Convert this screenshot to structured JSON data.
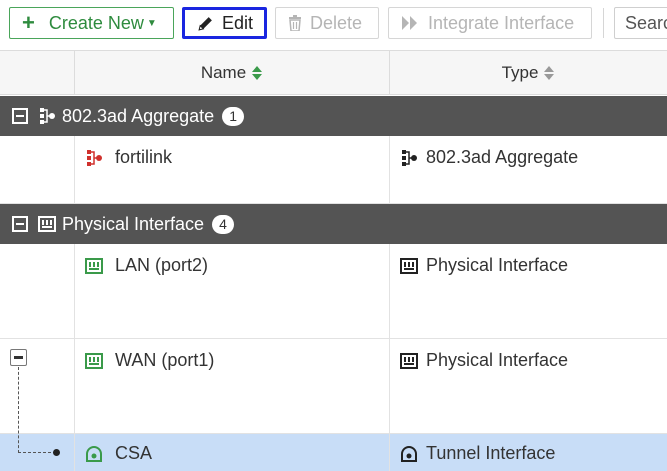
{
  "toolbar": {
    "create_label": "Create New",
    "edit_label": "Edit",
    "delete_label": "Delete",
    "integrate_label": "Integrate Interface",
    "search_placeholder": "Search"
  },
  "columns": {
    "name": "Name",
    "type": "Type"
  },
  "groups": [
    {
      "label": "802.3ad Aggregate",
      "count": "1"
    },
    {
      "label": "Physical Interface",
      "count": "4"
    }
  ],
  "rows": [
    {
      "name": "fortilink",
      "type": "802.3ad Aggregate",
      "name_icon": "aggregate-icon",
      "type_icon": "aggregate-icon"
    },
    {
      "name": "LAN (port2)",
      "type": "Physical Interface",
      "name_icon": "ethernet-port-icon",
      "type_icon": "ethernet-port-icon"
    },
    {
      "name": "WAN (port1)",
      "type": "Physical Interface",
      "name_icon": "ethernet-port-icon",
      "type_icon": "ethernet-port-icon"
    },
    {
      "name": "CSA",
      "type": "Tunnel Interface",
      "name_icon": "tunnel-icon",
      "type_icon": "tunnel-icon"
    }
  ],
  "colors": {
    "create_green": "#2e8b3e",
    "edit_highlight": "#1a26e0",
    "group_header": "#545454",
    "selected_row": "#c8ddf7",
    "port_green": "#3a9a4a",
    "aggregate_red": "#d0312d"
  }
}
